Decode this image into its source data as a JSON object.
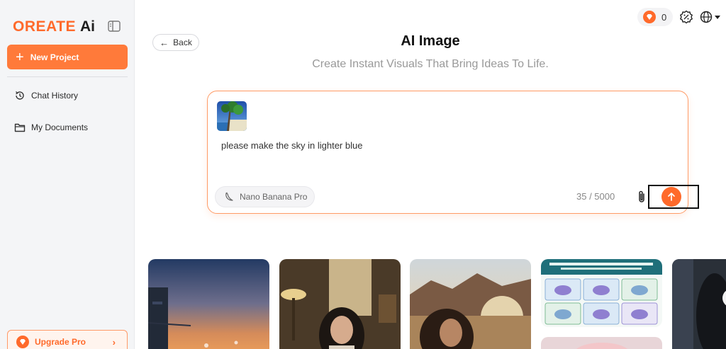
{
  "brand": {
    "name": "OREATE",
    "suffix": "Ai"
  },
  "sidebar": {
    "new_project_label": "New Project",
    "items": [
      {
        "label": "Chat History",
        "icon": "history-icon"
      },
      {
        "label": "My Documents",
        "icon": "folder-icon"
      }
    ],
    "upgrade_label": "Upgrade Pro"
  },
  "header": {
    "credits": "0"
  },
  "main": {
    "back_label": "Back",
    "title": "AI Image",
    "subtitle": "Create Instant Visuals That Bring Ideas To Life.",
    "composer": {
      "prompt": "please make the sky in lighter blue",
      "model": "Nano Banana Pro",
      "counter": "35 / 5000"
    },
    "gallery": [
      {
        "name": "sunset-cityscape"
      },
      {
        "name": "woman-portrait-interior"
      },
      {
        "name": "woman-mountain-sunset"
      },
      {
        "name": "crispr-infographic",
        "header": "CRISPR-Cas9 Gene Editing Mechanism: A Step-by-Step Guide"
      },
      {
        "name": "dark-portrait"
      }
    ]
  },
  "colors": {
    "accent": "#ff6a2b",
    "sidebar_bg": "#f4f5f7",
    "border_accent": "#ff9b66"
  }
}
